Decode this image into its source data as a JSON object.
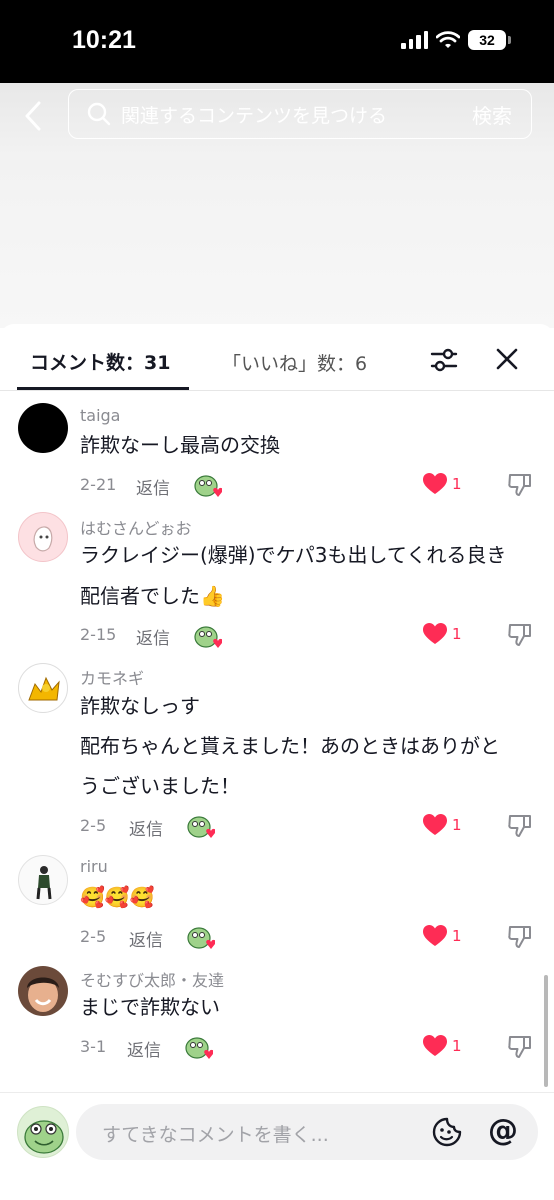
{
  "status_bar": {
    "time": "10:21",
    "battery": "32"
  },
  "search": {
    "placeholder": "関連するコンテンツを見つける",
    "button": "検索"
  },
  "tabs": {
    "comments": "コメント数：31",
    "likes": "「いいね」数：6"
  },
  "comments": [
    {
      "username": "taiga",
      "lines": [
        "詐欺なーし最高の交換"
      ],
      "date": "2-21",
      "reply": "返信",
      "likes": "1"
    },
    {
      "username": "はむさんどぉお",
      "lines": [
        "ラクレイジー(爆弾)でケパ3も出してくれる良き",
        "配信者でした👍"
      ],
      "date": "2-15",
      "reply": "返信",
      "likes": "1"
    },
    {
      "username": "カモネギ",
      "lines": [
        "詐欺なしっす",
        "配布ちゃんと貰えました！あのときはありがと",
        "うございました！"
      ],
      "date": "2-5",
      "reply": "返信",
      "likes": "1"
    },
    {
      "username": "riru",
      "lines": [
        "🥰🥰🥰"
      ],
      "date": "2-5",
      "reply": "返信",
      "likes": "1"
    },
    {
      "username": "そむすび太郎・友達",
      "lines": [
        "まじで詐欺ない"
      ],
      "date": "3-1",
      "reply": "返信",
      "likes": "1"
    }
  ],
  "input": {
    "placeholder": "すてきなコメントを書く..."
  },
  "icons": {
    "back": "chevron-left-icon",
    "search": "search-icon",
    "filter": "sliders-icon",
    "close": "close-icon",
    "sticker": "frog-sticker-icon",
    "heart": "heart-icon",
    "dislike": "thumbs-down-icon",
    "emoji": "emoji-icon",
    "mention": "at-icon"
  },
  "colors": {
    "like": "#fe2c55",
    "text": "#161823",
    "muted": "#8a8b91"
  }
}
